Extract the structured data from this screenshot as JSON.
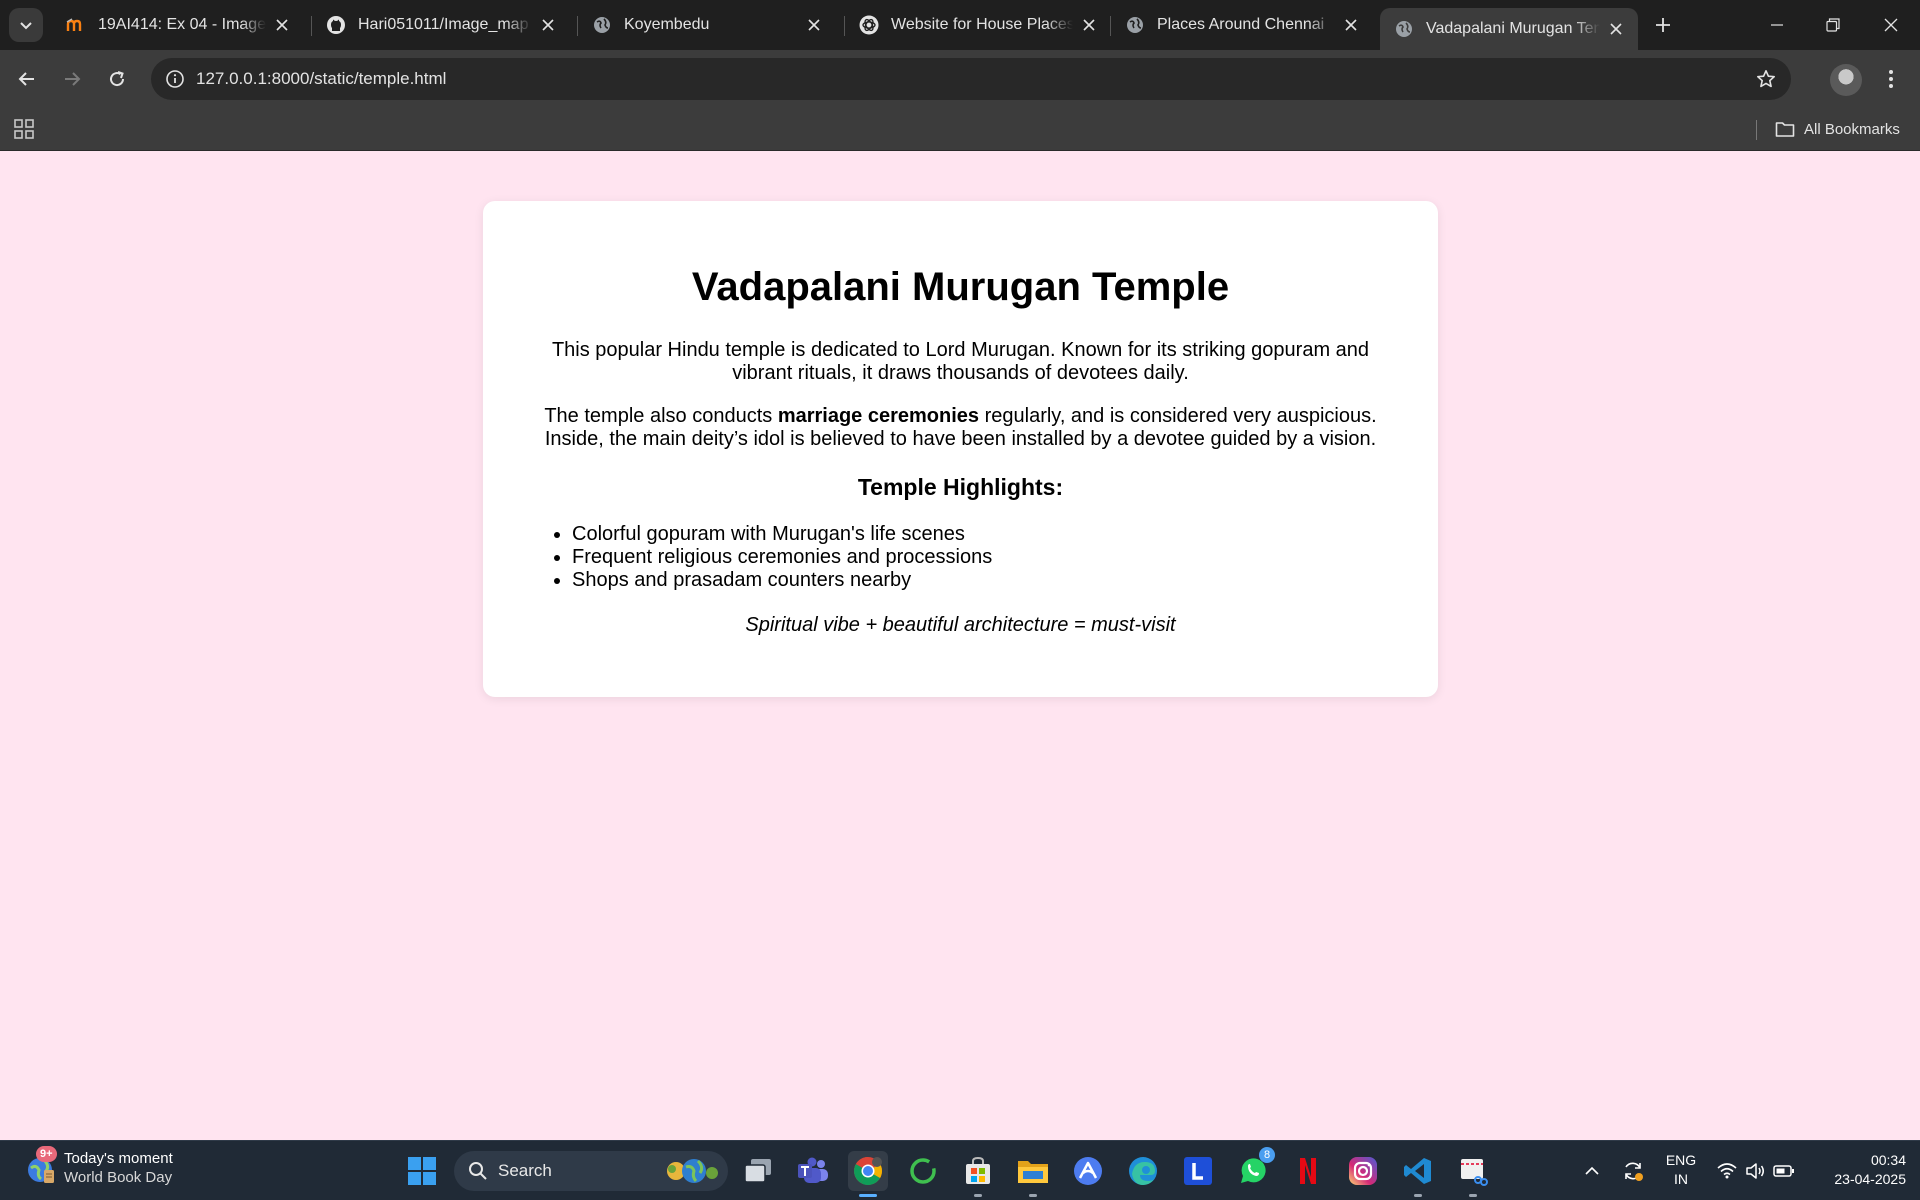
{
  "browser": {
    "tabs": [
      {
        "title": "19AI414: Ex 04 - Imagemap",
        "favicon": "moodle-icon"
      },
      {
        "title": "Hari051011/Image_map",
        "favicon": "github-icon"
      },
      {
        "title": "Koyembedu",
        "favicon": "globe-icon"
      },
      {
        "title": "Website for House Places",
        "favicon": "chatgpt-icon"
      },
      {
        "title": "Places Around Chennai",
        "favicon": "globe-icon"
      },
      {
        "title": "Vadapalani Murugan Temple",
        "favicon": "globe-icon",
        "active": true
      }
    ],
    "address": "127.0.0.1:8000/static/temple.html",
    "bookmarks": {
      "all_label": "All Bookmarks"
    }
  },
  "page": {
    "title": "Vadapalani Murugan Temple",
    "intro": "This popular Hindu temple is dedicated to Lord Murugan. Known for its striking gopuram and vibrant rituals, it draws thousands of devotees daily.",
    "para2_before": "The temple also conducts ",
    "para2_bold": "marriage ceremonies",
    "para2_after": " regularly, and is considered very auspicious. Inside, the main deity’s idol is believed to have been installed by a devotee guided by a vision.",
    "highlights_heading": "Temple Highlights:",
    "highlights": [
      "Colorful gopuram with Murugan's life scenes",
      "Frequent religious ceremonies and processions",
      "Shops and prasadam counters nearby"
    ],
    "tagline": "Spiritual vibe + beautiful architecture = must-visit"
  },
  "taskbar": {
    "widget": {
      "title": "Today's moment",
      "subtitle": "World Book Day",
      "badge": "9+"
    },
    "search_label": "Search",
    "whatsapp_badge": "8",
    "language": {
      "line1": "ENG",
      "line2": "IN"
    },
    "time": "00:34",
    "date": "23-04-2025"
  },
  "colors": {
    "page_background": "#ffe4f0",
    "card_background": "#ffffff",
    "browser_frame": "#1f1f1f",
    "toolbar": "#3c3c3c",
    "taskbar": "#202a36"
  }
}
